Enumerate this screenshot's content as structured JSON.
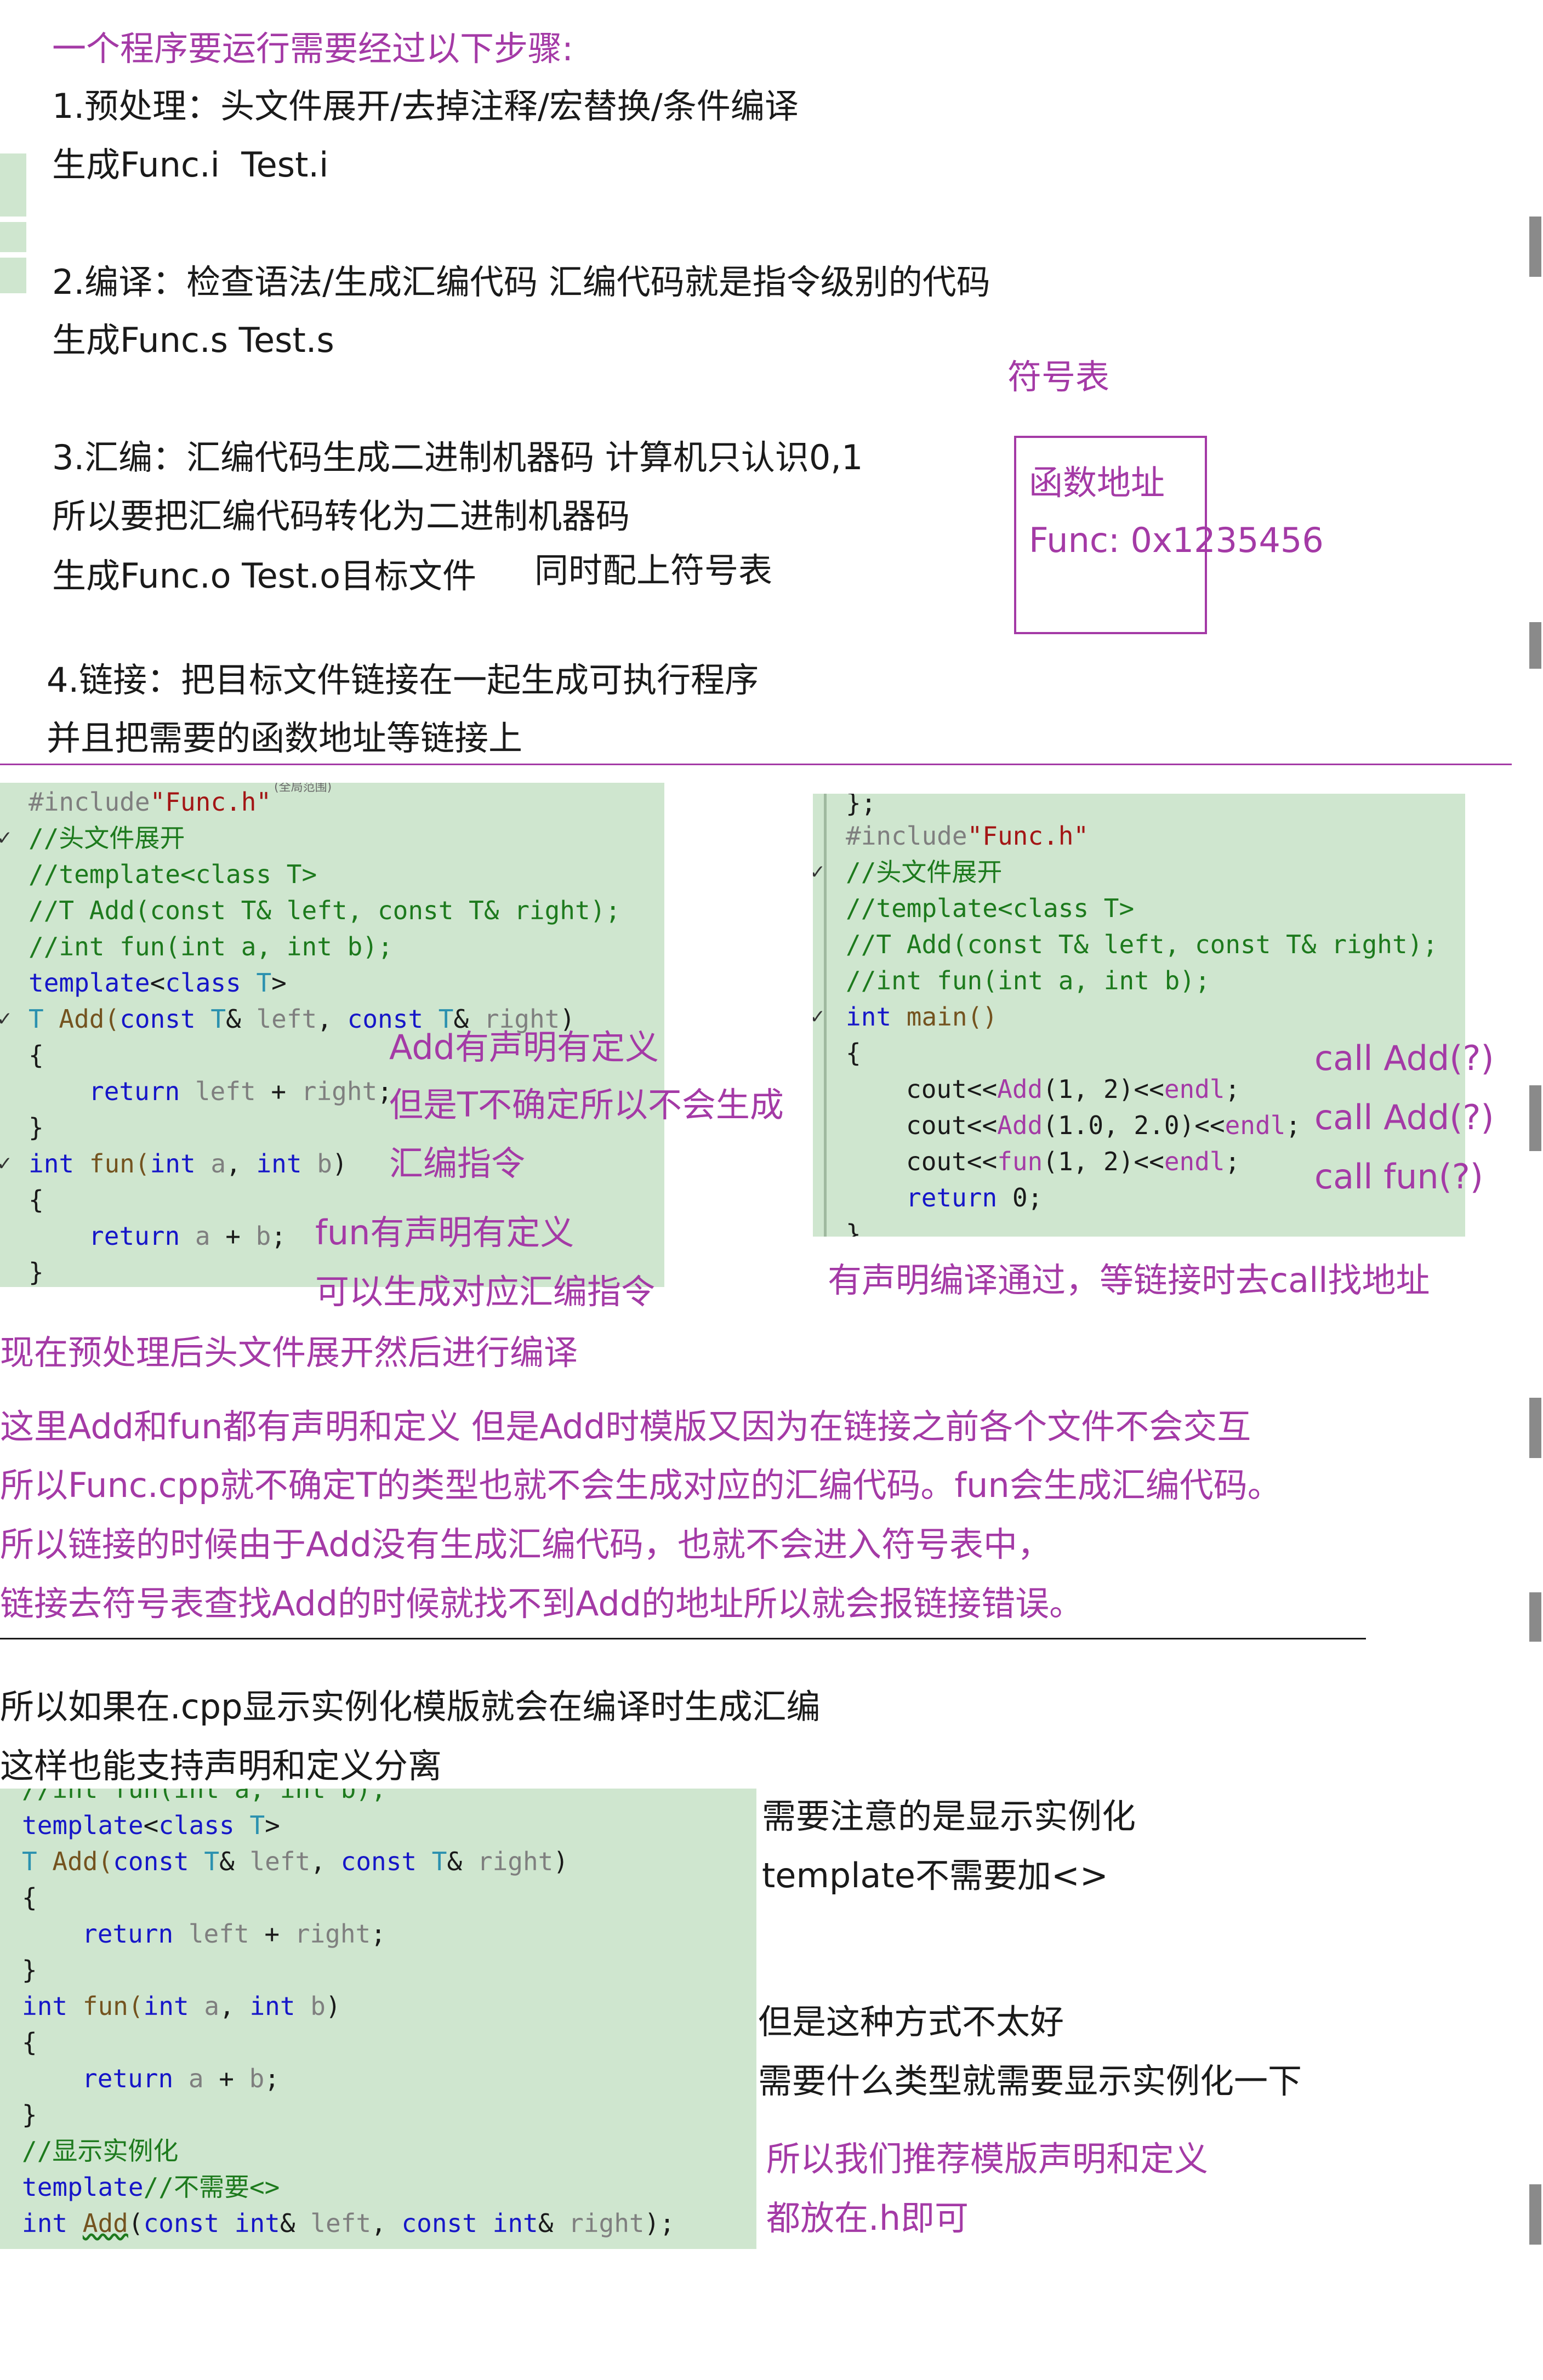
{
  "section1": {
    "heading": "一个程序要运行需要经过以下步骤:",
    "step1_a": "1.预处理：头文件展开/去掉注释/宏替换/条件编译",
    "step1_b": "生成Func.i  Test.i",
    "step2_a": "2.编译：检查语法/生成汇编代码 汇编代码就是指令级别的代码",
    "step2_b": "生成Func.s Test.s",
    "step3_a": "3.汇编：汇编代码生成二进制机器码 计算机只认识0,1",
    "step3_b": "所以要把汇编代码转化为二进制机器码",
    "step3_c": "生成Func.o Test.o目标文件",
    "step3_d": "同时配上符号表",
    "step4_a": "4.链接：把目标文件链接在一起生成可执行程序",
    "step4_b": "并且把需要的函数地址等链接上",
    "symbol_table_label": "符号表",
    "symbol_box_line1": "函数地址",
    "symbol_box_line2": "Func: 0x12",
    "symbol_box_line2b": "35456"
  },
  "code_left": {
    "faded_header": "(全局范围)",
    "lines": {
      "l1a": "#include",
      "l1b": "\"Func.h\"",
      "l2": "//头文件展开",
      "l3": "//template<class T>",
      "l4": "//T Add(const T& left, const T& right);",
      "l5": "//int fun(int a, int b);",
      "l6a": "template",
      "l6b": "<",
      "l6c": "class",
      "l6d": " T",
      "l6e": ">",
      "l7a": "T",
      "l7b": " Add(",
      "l7c": "const",
      "l7d": " T",
      "l7e": "& ",
      "l7f": "left",
      "l7g": ", ",
      "l7h": "const",
      "l7i": " T",
      "l7j": "& ",
      "l7k": "right",
      "l7l": ")",
      "l8": "{",
      "l9a": "return",
      "l9b": " left",
      "l9c": " + ",
      "l9d": "right",
      "l9e": ";",
      "l10": "}",
      "l11a": "int",
      "l11b": " fun(",
      "l11c": "int",
      "l11d": " a",
      "l11e": ", ",
      "l11f": "int",
      "l11g": " b",
      "l11h": ")",
      "l12": "{",
      "l13a": "return",
      "l13b": " a",
      "l13c": " + ",
      "l13d": "b",
      "l13e": ";",
      "l14": "}"
    },
    "annotations": {
      "a1": "Add有声明有定义",
      "a2": "但是T不确定所以不会生成",
      "a3": "汇编指令",
      "a4": "fun有声明有定义",
      "a5": "可以生成对应汇编指令"
    }
  },
  "code_right": {
    "lines": {
      "l0": "};",
      "l1a": "#include",
      "l1b": "\"Func.h\"",
      "l2": "//头文件展开",
      "l3": "//template<class T>",
      "l4": "//T Add(const T& left, const T& right);",
      "l5": "//int fun(int a, int b);",
      "l6a": "int",
      "l6b": " main()",
      "l7": "{",
      "l8a": "cout<<",
      "l8b": "Add",
      "l8c": "(1, 2)<<",
      "l8d": "endl",
      "l8e": ";",
      "l9a": "cout<<",
      "l9b": "Add",
      "l9c": "(1.0, 2.0)<<",
      "l9d": "endl",
      "l9e": ";",
      "l10a": "cout<<",
      "l10b": "fun",
      "l10c": "(1, 2)<<",
      "l10d": "endl",
      "l10e": ";",
      "l11a": "return",
      "l11b": " 0;",
      "l12": "}"
    },
    "annotations": {
      "c1": "call Add(?)",
      "c2": "call Add(?)",
      "c3": "call fun(?)",
      "note": "有声明编译通过，等链接时去call找地址"
    }
  },
  "section2": {
    "p1": "现在预处理后头文件展开然后进行编译",
    "p2": "这里Add和fun都有声明和定义 但是Add时模版又因为在链接之前各个文件不会交互",
    "p3": "所以Func.cpp就不确定T的类型也就不会生成对应的汇编代码。fun会生成汇编代码。",
    "p4": "所以链接的时候由于Add没有生成汇编代码，也就不会进入符号表中，",
    "p5": "链接去符号表查找Add的时候就找不到Add的地址所以就会报链接错误。"
  },
  "section3": {
    "p1": "所以如果在.cpp显示实例化模版就会在编译时生成汇编",
    "p2": "这样也能支持声明和定义分离",
    "note1": "需要注意的是显示实例化",
    "note2": "template不需要加<>",
    "note3": "但是这种方式不太好",
    "note4": "需要什么类型就需要显示实例化一下",
    "note5": "所以我们推荐模版声明和定义",
    "note6": "都放在.h即可"
  },
  "code_bottom": {
    "lines": {
      "l0": "//int fun(int a, int b);",
      "l1a": "template",
      "l1b": "<",
      "l1c": "class",
      "l1d": " T",
      "l1e": ">",
      "l2a": "T",
      "l2b": " Add(",
      "l2c": "const",
      "l2d": " T",
      "l2e": "& ",
      "l2f": "left",
      "l2g": ", ",
      "l2h": "const",
      "l2i": " T",
      "l2j": "& ",
      "l2k": "right",
      "l2l": ")",
      "l3": "{",
      "l4a": "return",
      "l4b": " left",
      "l4c": " + ",
      "l4d": "right",
      "l4e": ";",
      "l5": "}",
      "l6a": "int",
      "l6b": " fun(",
      "l6c": "int",
      "l6d": " a",
      "l6e": ", ",
      "l6f": "int",
      "l6g": " b",
      "l6h": ")",
      "l7": "{",
      "l8a": "return",
      "l8b": " a",
      "l8c": " + ",
      "l8d": "b",
      "l8e": ";",
      "l9": "}",
      "l10": "//显示实例化",
      "l11a": "template",
      "l11b": "//不需要<>",
      "l12a": "int",
      "l12b": " ",
      "l12c": "Add",
      "l12d": "(",
      "l12e": "const",
      "l12f": " ",
      "l12g": "int",
      "l12h": "& ",
      "l12i": "left",
      "l12j": ", ",
      "l12k": "const",
      "l12l": " ",
      "l12m": "int",
      "l12n": "& ",
      "l12o": "right",
      "l12p": ");"
    }
  },
  "colors": {
    "annotation": "#a43aa6",
    "code_bg": "#cfe6cf",
    "keyword": "#1616c8",
    "comment": "#1d7a1d",
    "string": "#a31515",
    "type": "#2b91af"
  }
}
